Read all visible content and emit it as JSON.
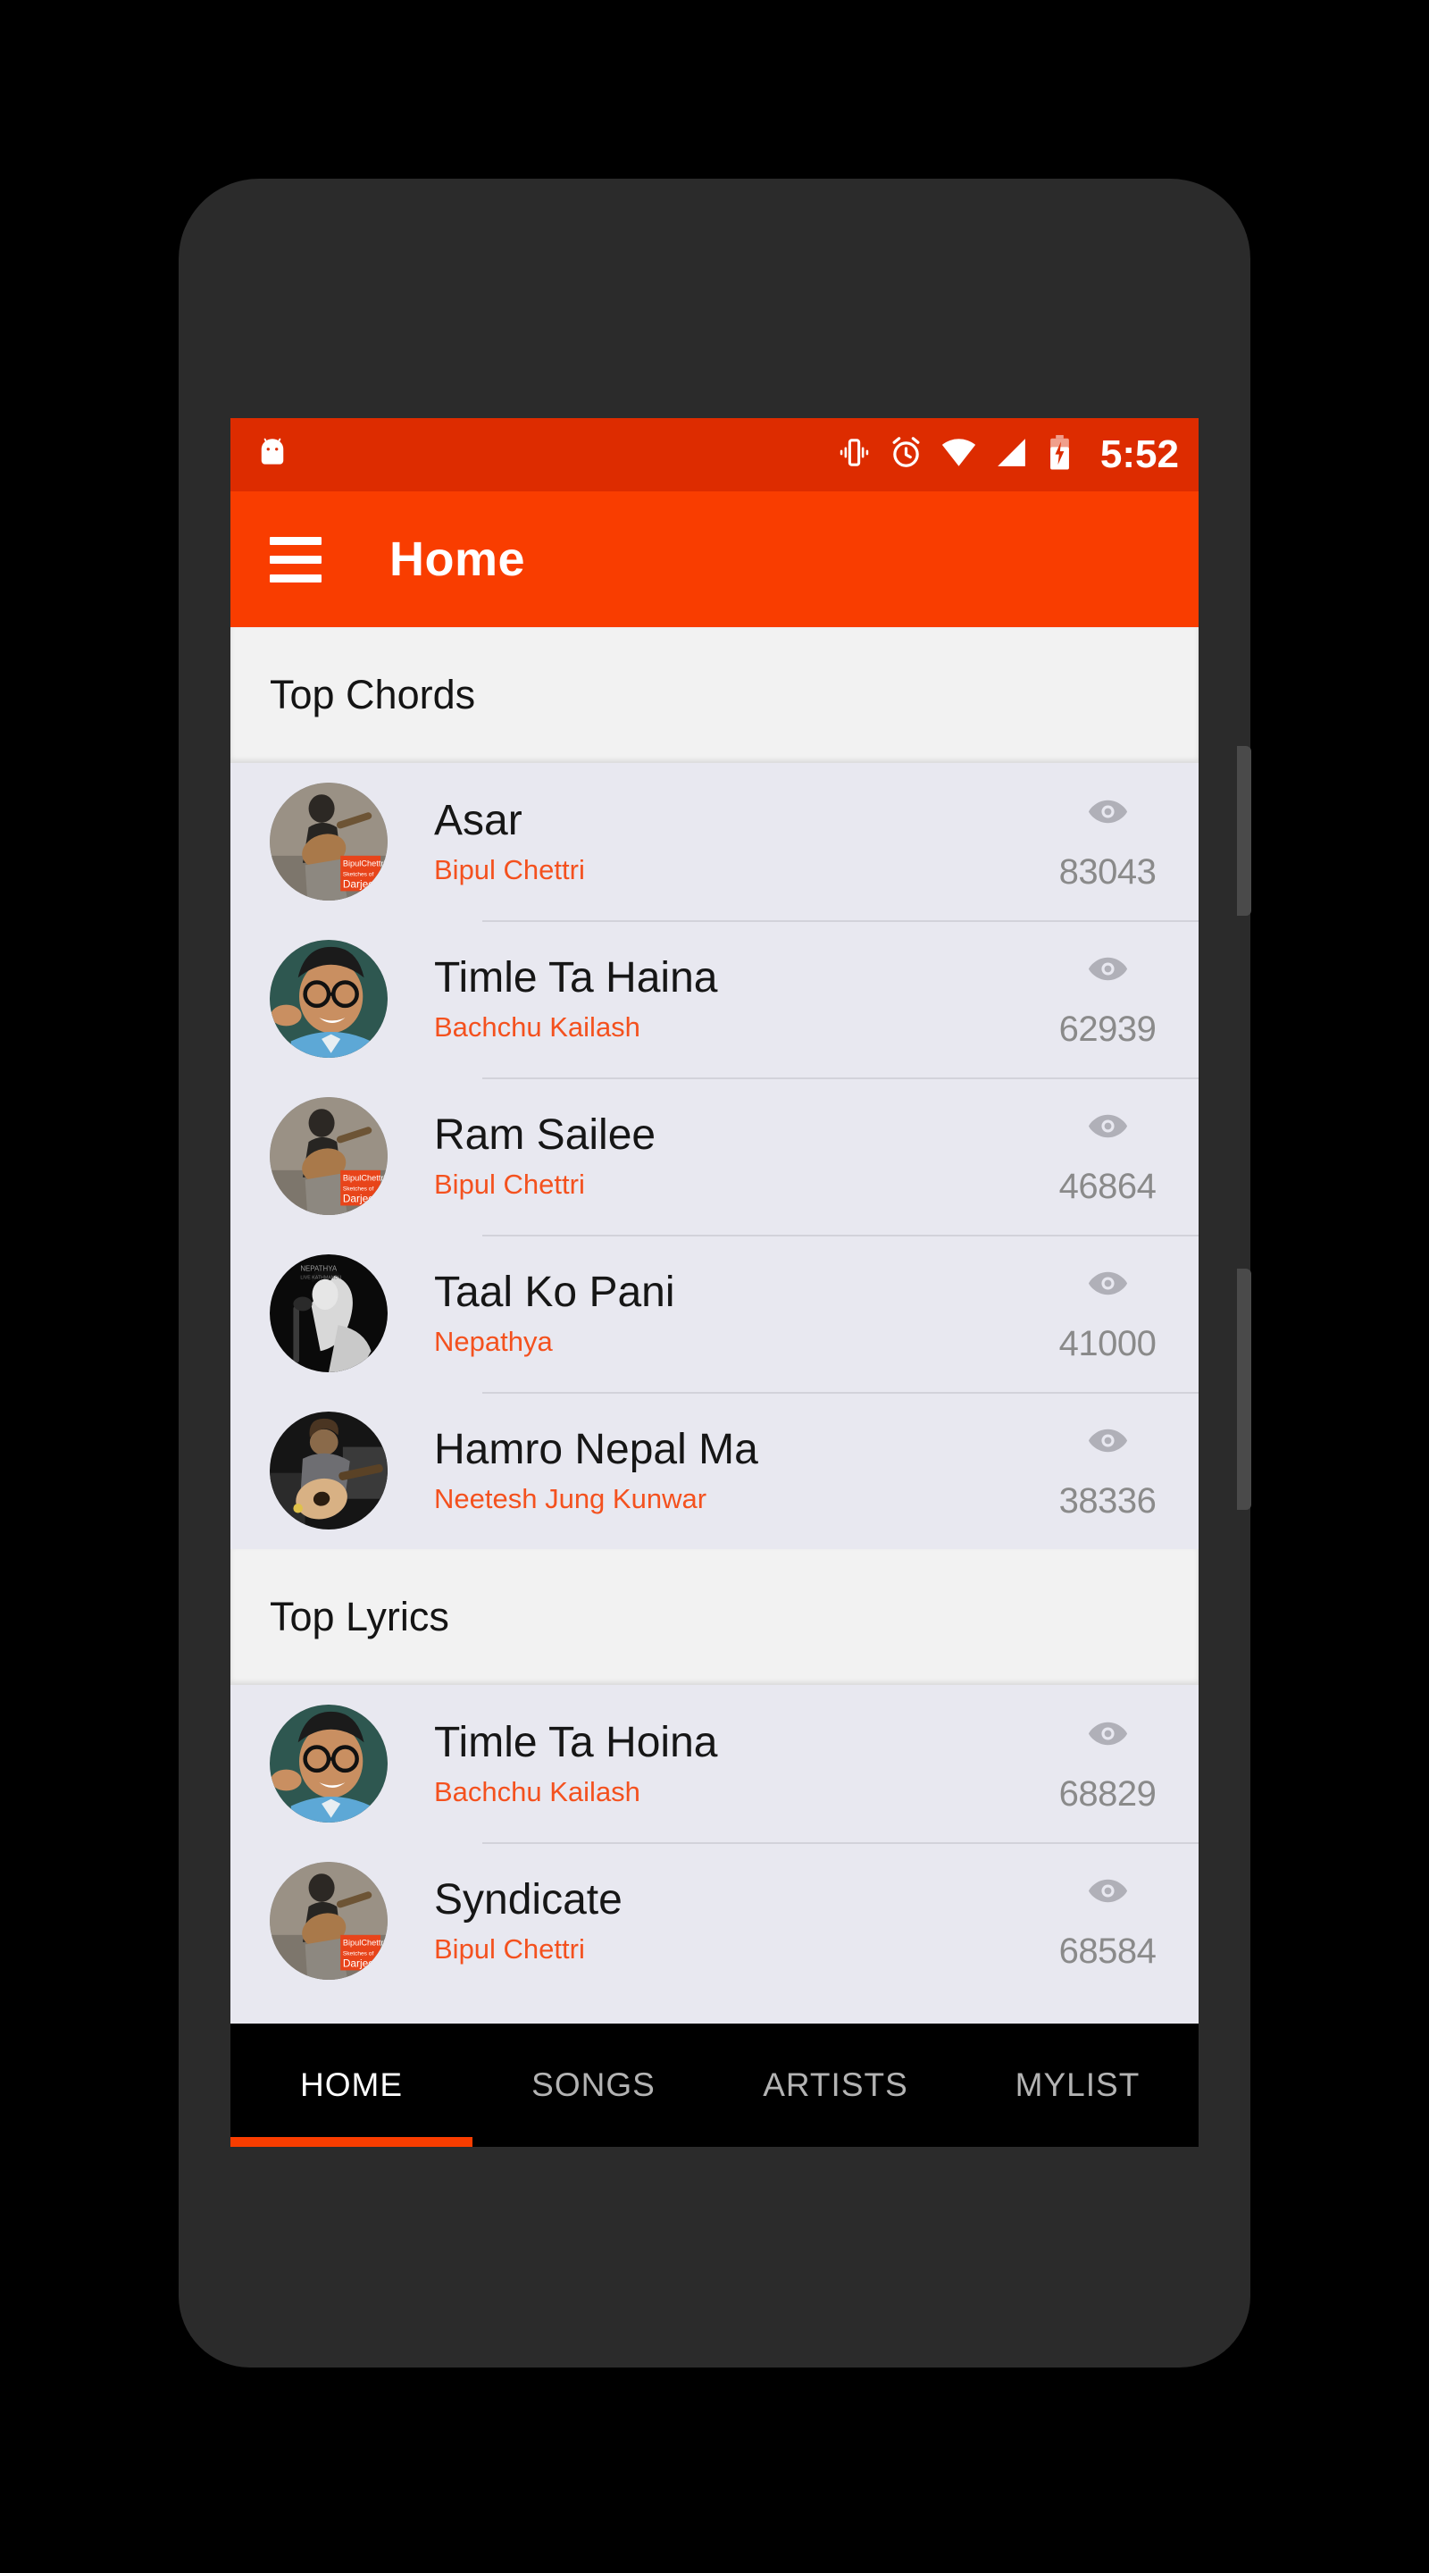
{
  "status_bar": {
    "time": "5:52",
    "icons": [
      "android-head-icon",
      "vibrate-icon",
      "alarm-icon",
      "wifi-icon",
      "signal-icon",
      "battery-charging-icon"
    ],
    "background_color": "#dd2c00"
  },
  "app_bar": {
    "menu_icon": "hamburger-menu-icon",
    "title": "Home",
    "background_color": "#f93d00"
  },
  "sections": [
    {
      "header": "Top Chords",
      "items": [
        {
          "title": "Asar",
          "artist": "Bipul Chettri",
          "views": "83043",
          "icon": "eye-icon",
          "avatar": "guitarist-sitting"
        },
        {
          "title": "Timle Ta Haina",
          "artist": "Bachchu Kailash",
          "views": "62939",
          "icon": "eye-icon",
          "avatar": "man-with-glasses"
        },
        {
          "title": "Ram Sailee",
          "artist": "Bipul Chettri",
          "views": "46864",
          "icon": "eye-icon",
          "avatar": "guitarist-sitting"
        },
        {
          "title": "Taal Ko Pani",
          "artist": "Nepathya",
          "views": "41000",
          "icon": "eye-icon",
          "avatar": "singer-bw"
        },
        {
          "title": "Hamro Nepal Ma",
          "artist": "Neetesh Jung Kunwar",
          "views": "38336",
          "icon": "eye-icon",
          "avatar": "guitarist-stage"
        }
      ]
    },
    {
      "header": "Top Lyrics",
      "items": [
        {
          "title": "Timle Ta Hoina",
          "artist": "Bachchu Kailash",
          "views": "68829",
          "icon": "eye-icon",
          "avatar": "man-with-glasses"
        },
        {
          "title": "Syndicate",
          "artist": "Bipul Chettri",
          "views": "68584",
          "icon": "eye-icon",
          "avatar": "guitarist-sitting"
        }
      ]
    }
  ],
  "bottom_nav": {
    "tabs": [
      {
        "label": "HOME",
        "active": true
      },
      {
        "label": "SONGS",
        "active": false
      },
      {
        "label": "ARTISTS",
        "active": false
      },
      {
        "label": "MYLIST",
        "active": false
      }
    ],
    "indicator_color": "#f93d00",
    "background_color": "#000000"
  },
  "colors": {
    "accent": "#f93d00",
    "status_bar": "#dd2c00",
    "artist_text": "#f4511e",
    "row_background": "#e8e8f0",
    "section_background": "#f2f2f2",
    "count_text": "#8a8a8a"
  }
}
